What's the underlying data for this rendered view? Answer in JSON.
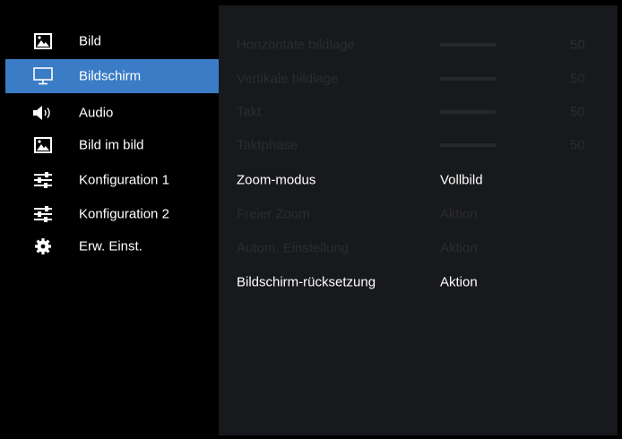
{
  "sidebar": {
    "items": [
      {
        "label": "Bild",
        "icon": "picture-icon",
        "active": false
      },
      {
        "label": "Bildschirm",
        "icon": "monitor-icon",
        "active": true
      },
      {
        "label": "Audio",
        "icon": "speaker-icon",
        "active": false
      },
      {
        "label": "Bild im bild",
        "icon": "picture-in-picture-icon",
        "active": false
      },
      {
        "label": "Konfiguration 1",
        "icon": "sliders-icon",
        "active": false
      },
      {
        "label": "Konfiguration 2",
        "icon": "sliders-icon",
        "active": false
      },
      {
        "label": "Erw. Einst.",
        "icon": "gear-icon",
        "active": false
      }
    ]
  },
  "settings": {
    "rows": [
      {
        "label": "Horizontale bildlage",
        "type": "slider",
        "value": "50",
        "enabled": false
      },
      {
        "label": "Vertikale bildlage",
        "type": "slider",
        "value": "50",
        "enabled": false
      },
      {
        "label": "Takt",
        "type": "slider",
        "value": "50",
        "enabled": false
      },
      {
        "label": "Taktphase",
        "type": "slider",
        "value": "50",
        "enabled": false
      },
      {
        "label": "Zoom-modus",
        "type": "option",
        "value": "Vollbild",
        "enabled": true
      },
      {
        "label": "Freier Zoom",
        "type": "action",
        "value": "Aktion",
        "enabled": false
      },
      {
        "label": "Autom. Einstellung",
        "type": "action",
        "value": "Aktion",
        "enabled": false
      },
      {
        "label": "Bildschirm-rücksetzung",
        "type": "action",
        "value": "Aktion",
        "enabled": true
      }
    ]
  },
  "colors": {
    "active_highlight": "#3a7cc6",
    "content_background": "#18191c",
    "disabled_text": "#2a2c31",
    "enabled_text": "#ffffff"
  }
}
